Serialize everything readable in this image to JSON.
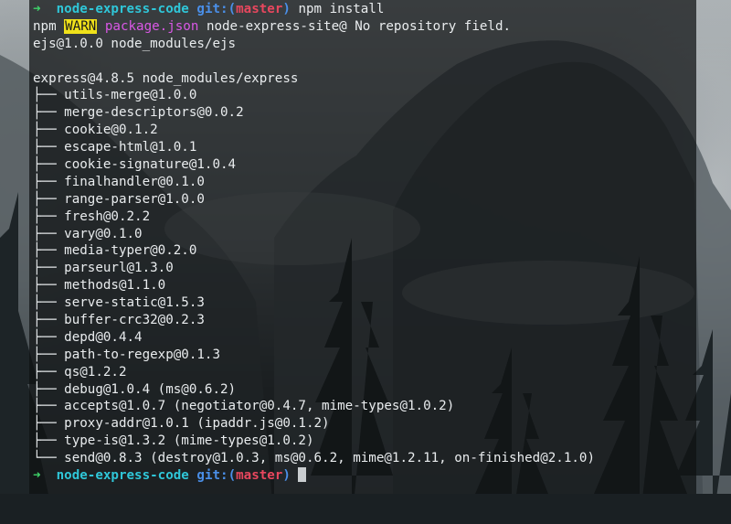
{
  "prompt1": {
    "arrow": "➜",
    "dir": "node-express-code",
    "git_prefix": "git:(",
    "branch": "master",
    "git_suffix": ")",
    "command": "npm install"
  },
  "warn_line": {
    "npm": "npm",
    "level": "WARN",
    "file": "package.json",
    "message": "node-express-site@ No repository field."
  },
  "ejs_line": "ejs@1.0.0 node_modules/ejs",
  "express_line": "express@4.8.5 node_modules/express",
  "deps": [
    {
      "branch": "├──",
      "name": "utils-merge@1.0.0"
    },
    {
      "branch": "├──",
      "name": "merge-descriptors@0.0.2"
    },
    {
      "branch": "├──",
      "name": "cookie@0.1.2"
    },
    {
      "branch": "├──",
      "name": "escape-html@1.0.1"
    },
    {
      "branch": "├──",
      "name": "cookie-signature@1.0.4"
    },
    {
      "branch": "├──",
      "name": "finalhandler@0.1.0"
    },
    {
      "branch": "├──",
      "name": "range-parser@1.0.0"
    },
    {
      "branch": "├──",
      "name": "fresh@0.2.2"
    },
    {
      "branch": "├──",
      "name": "vary@0.1.0"
    },
    {
      "branch": "├──",
      "name": "media-typer@0.2.0"
    },
    {
      "branch": "├──",
      "name": "parseurl@1.3.0"
    },
    {
      "branch": "├──",
      "name": "methods@1.1.0"
    },
    {
      "branch": "├──",
      "name": "serve-static@1.5.3"
    },
    {
      "branch": "├──",
      "name": "buffer-crc32@0.2.3"
    },
    {
      "branch": "├──",
      "name": "depd@0.4.4"
    },
    {
      "branch": "├──",
      "name": "path-to-regexp@0.1.3"
    },
    {
      "branch": "├──",
      "name": "qs@1.2.2"
    },
    {
      "branch": "├──",
      "name": "debug@1.0.4 (ms@0.6.2)"
    },
    {
      "branch": "├──",
      "name": "accepts@1.0.7 (negotiator@0.4.7, mime-types@1.0.2)"
    },
    {
      "branch": "├──",
      "name": "proxy-addr@1.0.1 (ipaddr.js@0.1.2)"
    },
    {
      "branch": "├──",
      "name": "type-is@1.3.2 (mime-types@1.0.2)"
    },
    {
      "branch": "└──",
      "name": "send@0.8.3 (destroy@1.0.3, ms@0.6.2, mime@1.2.11, on-finished@2.1.0)"
    }
  ],
  "prompt2": {
    "arrow": "➜",
    "dir": "node-express-code",
    "git_prefix": "git:(",
    "branch": "master",
    "git_suffix": ")"
  },
  "colors": {
    "prompt_arrow": "#3fd46a",
    "dir": "#2fc6d8",
    "git": "#4a8fe8",
    "branch": "#e8475e",
    "warn_bg": "#f0e11a",
    "file": "#d958e6",
    "text": "#e9ecee"
  }
}
